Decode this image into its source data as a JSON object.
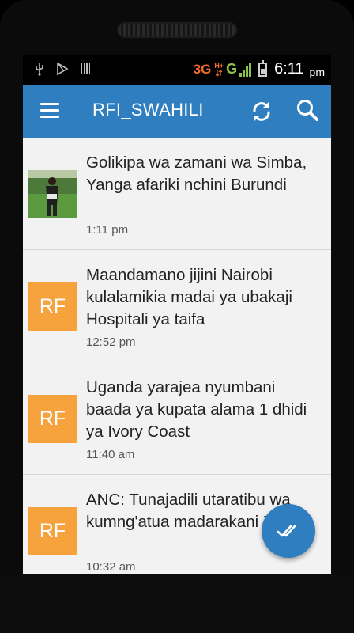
{
  "status_bar": {
    "left_icons": [
      "usb-icon",
      "play-store-icon",
      "barcode-icon"
    ],
    "network_3g": "3G",
    "network_h_plus": "H+",
    "network_g": "G",
    "time": "6:11",
    "ampm": "pm"
  },
  "app_bar": {
    "title": "RFI_SWAHILI",
    "icons": [
      "menu-icon",
      "refresh-icon",
      "search-icon"
    ]
  },
  "articles": [
    {
      "title": "Golikipa wa zamani wa Simba, Yanga afariki nchini Burundi",
      "time": "1:11 pm",
      "thumb": "photo",
      "thumb_text": ""
    },
    {
      "title": "Maandamano jijini Nairobi kulalamikia madai ya ubakaji Hospitali ya taifa",
      "time": "12:52 pm",
      "thumb": "placeholder",
      "thumb_text": "RF"
    },
    {
      "title": "Uganda yarajea nyumbani baada ya kupata alama 1 dhidi ya Ivory Coast",
      "time": "11:40 am",
      "thumb": "placeholder",
      "thumb_text": "RF"
    },
    {
      "title": "ANC: Tunajadili utaratibu wa kumng'atua madarakani Zuma",
      "time": "10:32 am",
      "thumb": "placeholder",
      "thumb_text": "RF"
    }
  ],
  "fab": {
    "icon": "double-check-icon"
  },
  "colors": {
    "accent": "#2f7ec0",
    "placeholder_thumb": "#f6a23d",
    "network_3g": "#f26a2e",
    "network_g": "#8bc34a"
  }
}
